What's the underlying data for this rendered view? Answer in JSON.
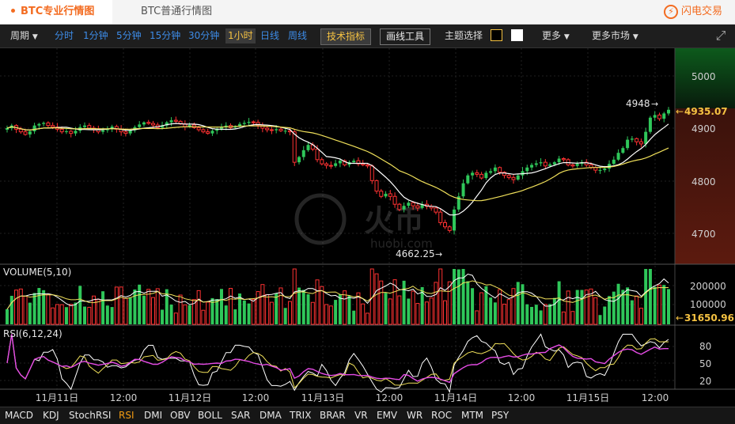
{
  "tabs": {
    "active": "BTC专业行情图",
    "other": "BTC普通行情图"
  },
  "brand": {
    "label": "闪电交易",
    "icon": "lightning-icon"
  },
  "toolbar": {
    "period_label": "周期",
    "intervals": [
      "分时",
      "1分钟",
      "5分钟",
      "15分钟",
      "30分钟",
      "1小时",
      "日线",
      "周线"
    ],
    "selected_interval": "1小时",
    "tech_label": "技术指标",
    "draw_label": "画线工具",
    "theme_label": "主题选择",
    "more_label": "更多",
    "more_market_label": "更多市场"
  },
  "colors": {
    "up": "#2fc75a",
    "down": "#ff3232",
    "ma_fast": "#ffffff",
    "ma_slow": "#f0e05a",
    "rsi_mid": "#e64ce6",
    "accent": "#f5c242"
  },
  "price_axis": {
    "ticks": [
      "5000",
      "4900",
      "4800",
      "4700"
    ],
    "current": "4935.07",
    "high_label": "4948",
    "low_label": "4662.25"
  },
  "volume": {
    "title": "VOLUME(5,10)",
    "ticks": [
      "200000",
      "100000"
    ],
    "current": "31650.96"
  },
  "rsi": {
    "title": "RSI(6,12,24)",
    "ticks": [
      "80",
      "50",
      "20"
    ]
  },
  "time_axis": [
    "11月11日",
    "12:00",
    "11月12日",
    "12:00",
    "11月13日",
    "12:00",
    "11月14日",
    "12:00",
    "11月15日",
    "12:00"
  ],
  "indicators": [
    "MACD",
    "KDJ",
    "StochRSI",
    "RSI",
    "DMI",
    "OBV",
    "BOLL",
    "SAR",
    "DMA",
    "TRIX",
    "BRAR",
    "VR",
    "EMV",
    "WR",
    "ROC",
    "MTM",
    "PSY"
  ],
  "selected_indicator": "RSI",
  "watermark": {
    "cn": "火币",
    "en": "huobi.com"
  },
  "chart_data": {
    "type": "candlestick",
    "close_series": [
      4900,
      4905,
      4898,
      4893,
      4888,
      4894,
      4905,
      4908,
      4910,
      4905,
      4902,
      4898,
      4893,
      4894,
      4890,
      4895,
      4902,
      4905,
      4900,
      4897,
      4893,
      4896,
      4899,
      4903,
      4898,
      4893,
      4890,
      4896,
      4902,
      4907,
      4911,
      4909,
      4906,
      4901,
      4905,
      4911,
      4915,
      4913,
      4908,
      4903,
      4906,
      4901,
      4897,
      4893,
      4890,
      4895,
      4899,
      4902,
      4905,
      4901,
      4903,
      4908,
      4910,
      4912,
      4911,
      4906,
      4900,
      4897,
      4896,
      4898,
      4895,
      4895,
      4893,
      4835,
      4845,
      4858,
      4868,
      4860,
      4840,
      4832,
      4829,
      4828,
      4833,
      4838,
      4830,
      4835,
      4838,
      4832,
      4830,
      4828,
      4800,
      4780,
      4770,
      4775,
      4770,
      4755,
      4745,
      4752,
      4758,
      4752,
      4748,
      4755,
      4751,
      4748,
      4740,
      4720,
      4712,
      4705,
      4745,
      4770,
      4795,
      4810,
      4815,
      4812,
      4805,
      4815,
      4818,
      4825,
      4816,
      4810,
      4806,
      4802,
      4810,
      4818,
      4825,
      4830,
      4833,
      4835,
      4828,
      4831,
      4835,
      4842,
      4840,
      4830,
      4828,
      4832,
      4835,
      4830,
      4825,
      4820,
      4820,
      4823,
      4832,
      4840,
      4853,
      4862,
      4878,
      4880,
      4874,
      4870,
      4893,
      4920,
      4925,
      4918,
      4928,
      4935
    ]
  }
}
